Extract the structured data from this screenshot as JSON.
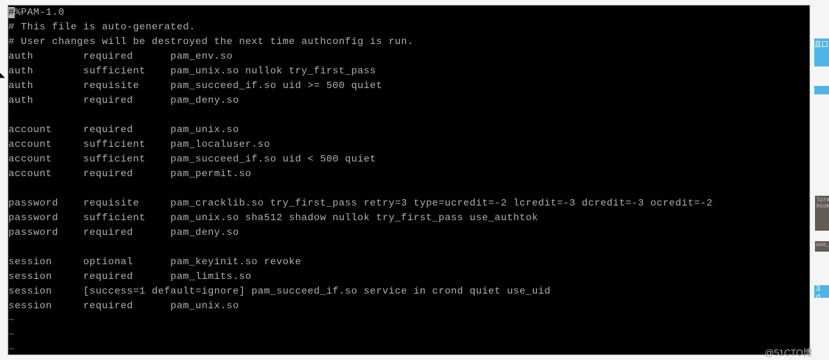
{
  "terminal": {
    "lines": [
      {
        "text": "#%PAM-1.0",
        "highlight_first": true
      },
      {
        "text": "# This file is auto-generated."
      },
      {
        "text": "# User changes will be destroyed the next time authconfig is run."
      },
      {
        "text": "auth        required      pam_env.so"
      },
      {
        "text": "auth        sufficient    pam_unix.so nullok try_first_pass"
      },
      {
        "text": "auth        requisite     pam_succeed_if.so uid >= 500 quiet"
      },
      {
        "text": "auth        required      pam_deny.so"
      },
      {
        "text": ""
      },
      {
        "text": "account     required      pam_unix.so"
      },
      {
        "text": "account     sufficient    pam_localuser.so"
      },
      {
        "text": "account     sufficient    pam_succeed_if.so uid < 500 quiet"
      },
      {
        "text": "account     required      pam_permit.so"
      },
      {
        "text": ""
      },
      {
        "text": "password    requisite     pam_cracklib.so try_first_pass retry=3 type=ucredit=-2 lcredit=-3 dcredit=-3 ocredit=-2"
      },
      {
        "text": "password    sufficient    pam_unix.so sha512 shadow nullok try_first_pass use_authtok"
      },
      {
        "text": "password    required      pam_deny.so"
      },
      {
        "text": ""
      },
      {
        "text": "session     optional      pam_keyinit.so revoke"
      },
      {
        "text": "session     required      pam_limits.so"
      },
      {
        "text": "session     [success=1 default=ignore] pam_succeed_if.so service in crond quiet use_uid"
      },
      {
        "text": "session     required      pam_unix.so"
      }
    ],
    "tildes": [
      "~",
      "~",
      "~"
    ]
  },
  "side": {
    "block_a": "且口",
    "block_c": "lcre\nhtok",
    "block_d": "use_",
    "block_e": "3 d"
  },
  "watermark": "@51CTO博",
  "cursor_left": "◣"
}
